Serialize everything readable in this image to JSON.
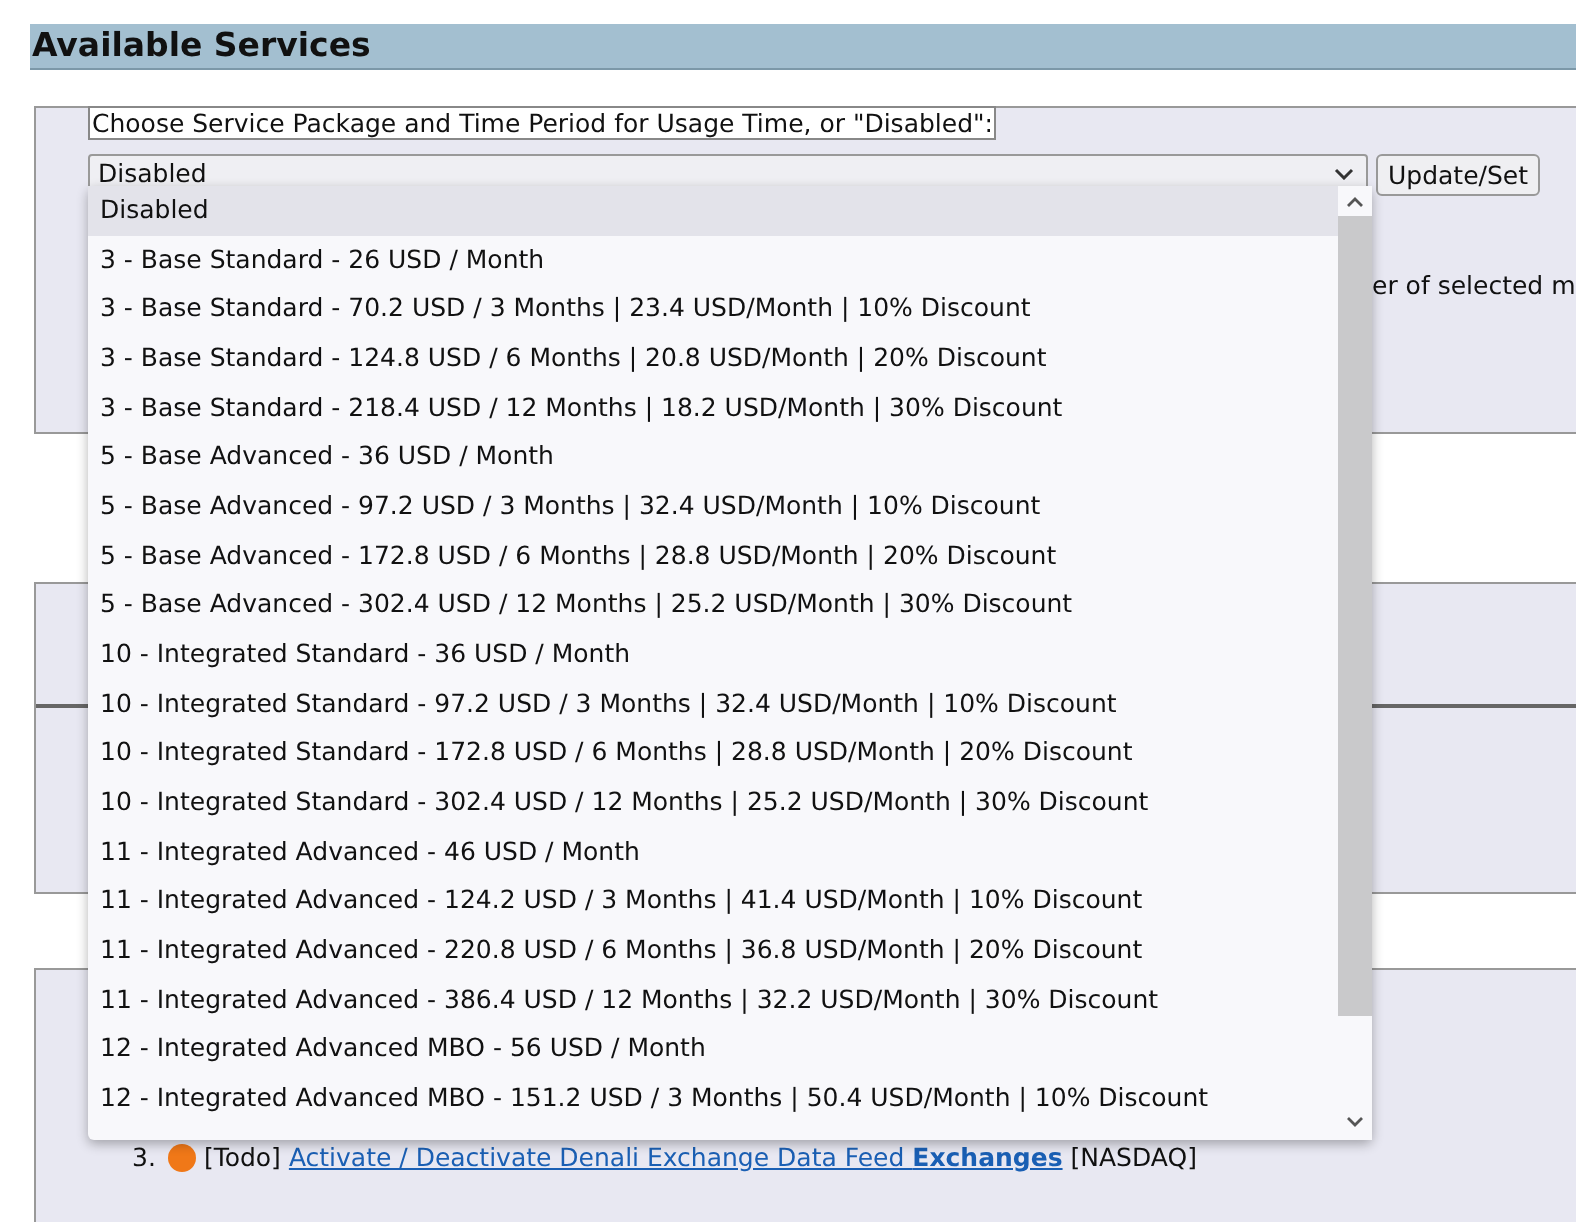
{
  "title": "Available Services",
  "package_field": {
    "legend": "Choose Service Package and Time Period for Usage Time, or \"Disabled\":",
    "value": "Disabled",
    "button": "Update/Set",
    "dropdown_open": true,
    "options": [
      {
        "label": "Disabled",
        "selected": true
      },
      {
        "label": "3 - Base Standard - 26 USD / Month",
        "selected": false
      },
      {
        "label": "3 - Base Standard - 70.2 USD / 3 Months | 23.4 USD/Month | 10% Discount",
        "selected": false
      },
      {
        "label": "3 - Base Standard - 124.8 USD / 6 Months | 20.8 USD/Month | 20% Discount",
        "selected": false
      },
      {
        "label": "3 - Base Standard - 218.4 USD / 12 Months | 18.2 USD/Month | 30% Discount",
        "selected": false
      },
      {
        "label": "5 - Base Advanced - 36 USD / Month",
        "selected": false
      },
      {
        "label": "5 - Base Advanced - 97.2 USD / 3 Months | 32.4 USD/Month | 10% Discount",
        "selected": false
      },
      {
        "label": "5 - Base Advanced - 172.8 USD / 6 Months | 28.8 USD/Month | 20% Discount",
        "selected": false
      },
      {
        "label": "5 - Base Advanced - 302.4 USD / 12 Months | 25.2 USD/Month | 30% Discount",
        "selected": false
      },
      {
        "label": "10 - Integrated Standard - 36 USD / Month",
        "selected": false
      },
      {
        "label": "10 - Integrated Standard - 97.2 USD / 3 Months | 32.4 USD/Month | 10% Discount",
        "selected": false
      },
      {
        "label": "10 - Integrated Standard - 172.8 USD / 6 Months | 28.8 USD/Month | 20% Discount",
        "selected": false
      },
      {
        "label": "10 - Integrated Standard - 302.4 USD / 12 Months | 25.2 USD/Month | 30% Discount",
        "selected": false
      },
      {
        "label": "11 - Integrated Advanced - 46 USD / Month",
        "selected": false
      },
      {
        "label": "11 - Integrated Advanced - 124.2 USD / 3 Months | 41.4 USD/Month | 10% Discount",
        "selected": false
      },
      {
        "label": "11 - Integrated Advanced - 220.8 USD / 6 Months | 36.8 USD/Month | 20% Discount",
        "selected": false
      },
      {
        "label": "11 - Integrated Advanced - 386.4 USD / 12 Months | 32.2 USD/Month | 30% Discount",
        "selected": false
      },
      {
        "label": "12 - Integrated Advanced MBO - 56 USD / Month",
        "selected": false
      },
      {
        "label": "12 - Integrated Advanced MBO - 151.2 USD / 3 Months | 50.4 USD/Month | 10% Discount",
        "selected": false
      }
    ]
  },
  "partial_note": "er of selected m",
  "tasks": [
    {
      "number": "3.",
      "color": "#f07818",
      "tag": "[Todo]",
      "link": "Activate / Deactivate Denali Exchange Data Feed **Exchanges**",
      "suffix": "[NASDAQ]"
    }
  ]
}
